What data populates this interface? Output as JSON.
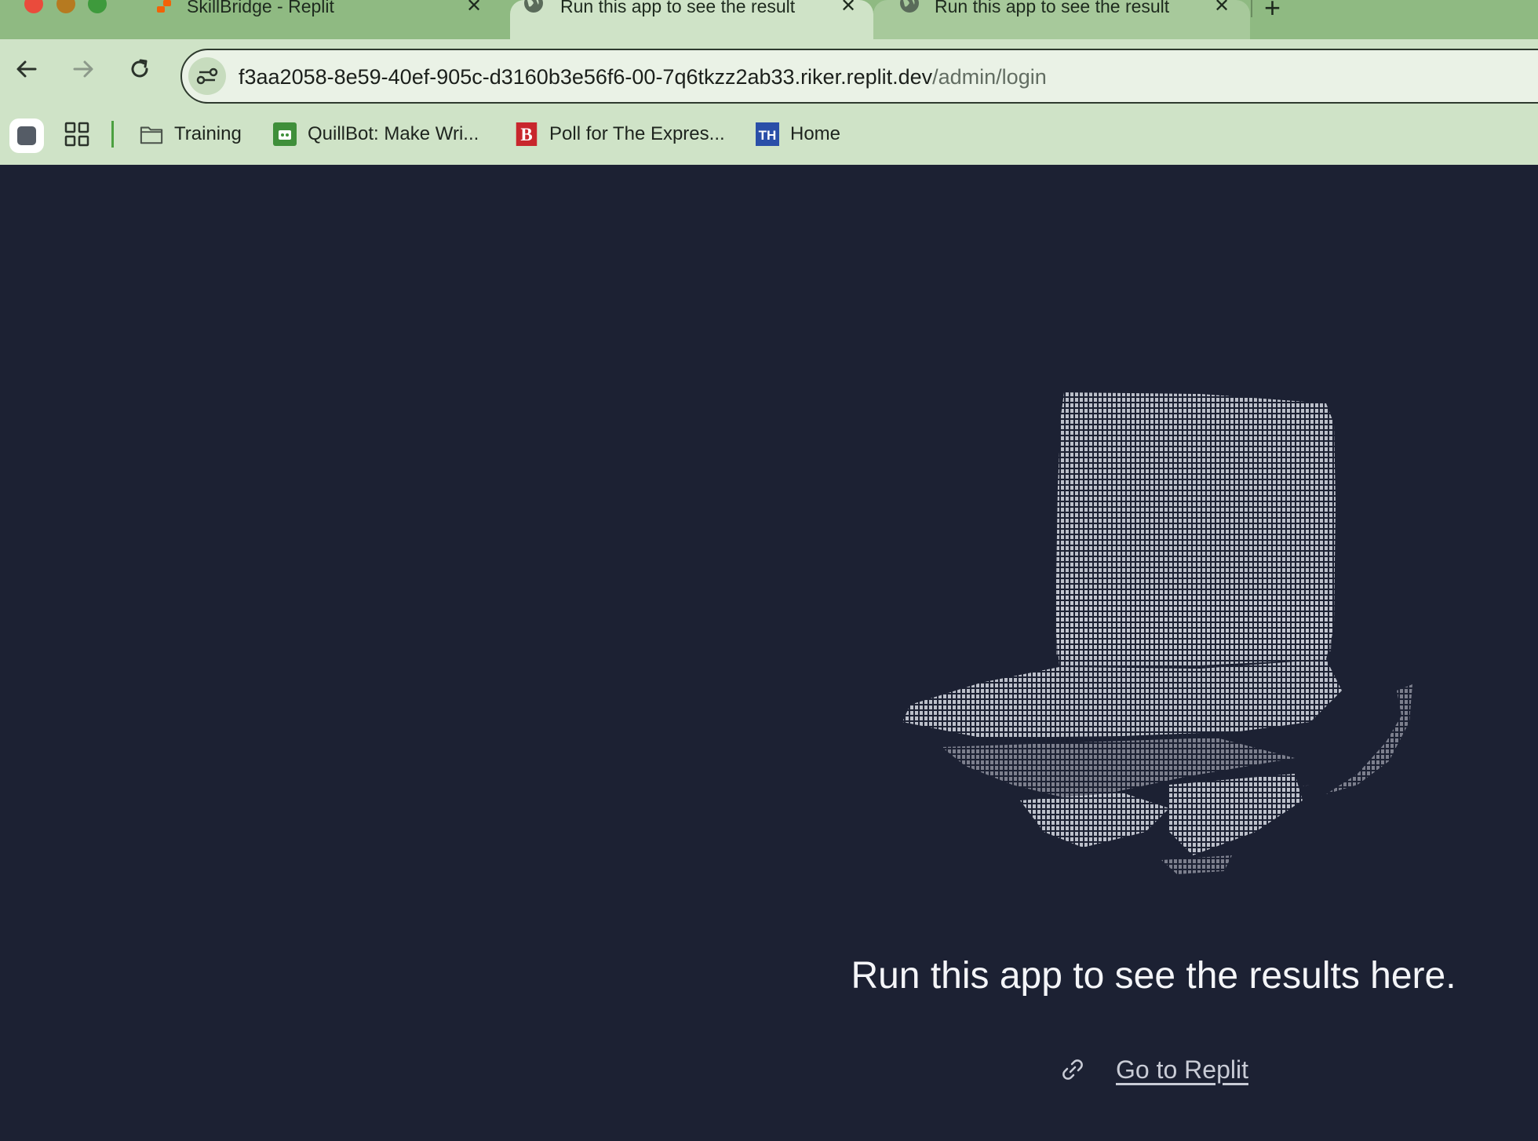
{
  "browser": {
    "tabs": [
      {
        "title": "SkillBridge - Replit",
        "favicon": "replit-icon",
        "active": false
      },
      {
        "title": "Run this app to see the result",
        "favicon": "globe-icon",
        "active": true
      },
      {
        "title": "Run this app to see the result",
        "favicon": "globe-icon",
        "active": false
      }
    ],
    "new_tab_label": "+",
    "close_label": "✕",
    "address": {
      "host": "f3aa2058-8e59-40ef-905c-d3160b3e56f6-00-7q6tkzz2ab33.riker.replit.dev",
      "path": "/admin/login"
    },
    "bookmarks": [
      {
        "label": "Training",
        "icon": "folder-icon"
      },
      {
        "label": "QuillBot: Make Wri...",
        "icon": "quillbot-icon"
      },
      {
        "label": "Poll for The Expres...",
        "icon": "b-logo-icon"
      },
      {
        "label": "Home",
        "icon": "th-logo-icon"
      }
    ]
  },
  "page": {
    "message": "Run this app to see the results here.",
    "link_label": "Go to Replit",
    "illustration": "ascii-art-replit-hat"
  },
  "colors": {
    "background": "#1c2133",
    "tab_strip": "#8fba82",
    "toolbar": "#cfe3c7",
    "text": "#f4f5f8"
  }
}
